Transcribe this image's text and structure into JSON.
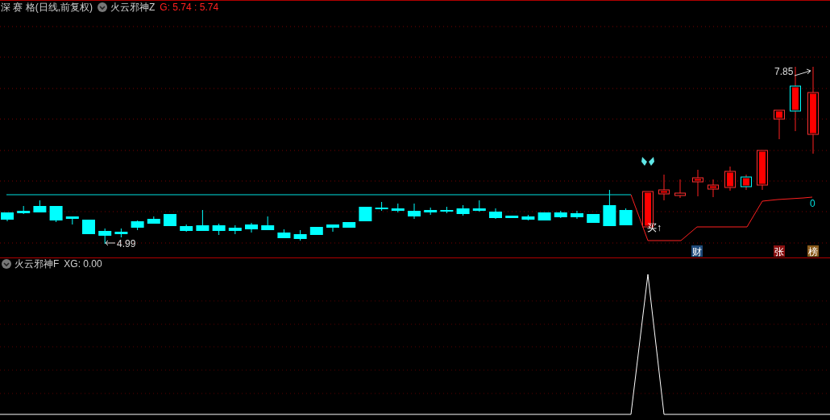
{
  "main_pane": {
    "stock_title": "深 赛 格(日线,前复权)",
    "indicator_name": "火云邪神Z",
    "indicator_values": "G: 5.74 : 5.74",
    "high_label": "7.85",
    "low_label": "4.99",
    "signal_label": "买↑",
    "line_value": "0",
    "badges": [
      {
        "text": "财",
        "color": "#1e4a7a"
      },
      {
        "text": "张",
        "color": "#8a1010"
      },
      {
        "text": "榜",
        "color": "#8a5a1a"
      }
    ]
  },
  "lower_pane": {
    "indicator_name": "火云邪神F",
    "indicator_values": "XG: 0.00"
  }
}
